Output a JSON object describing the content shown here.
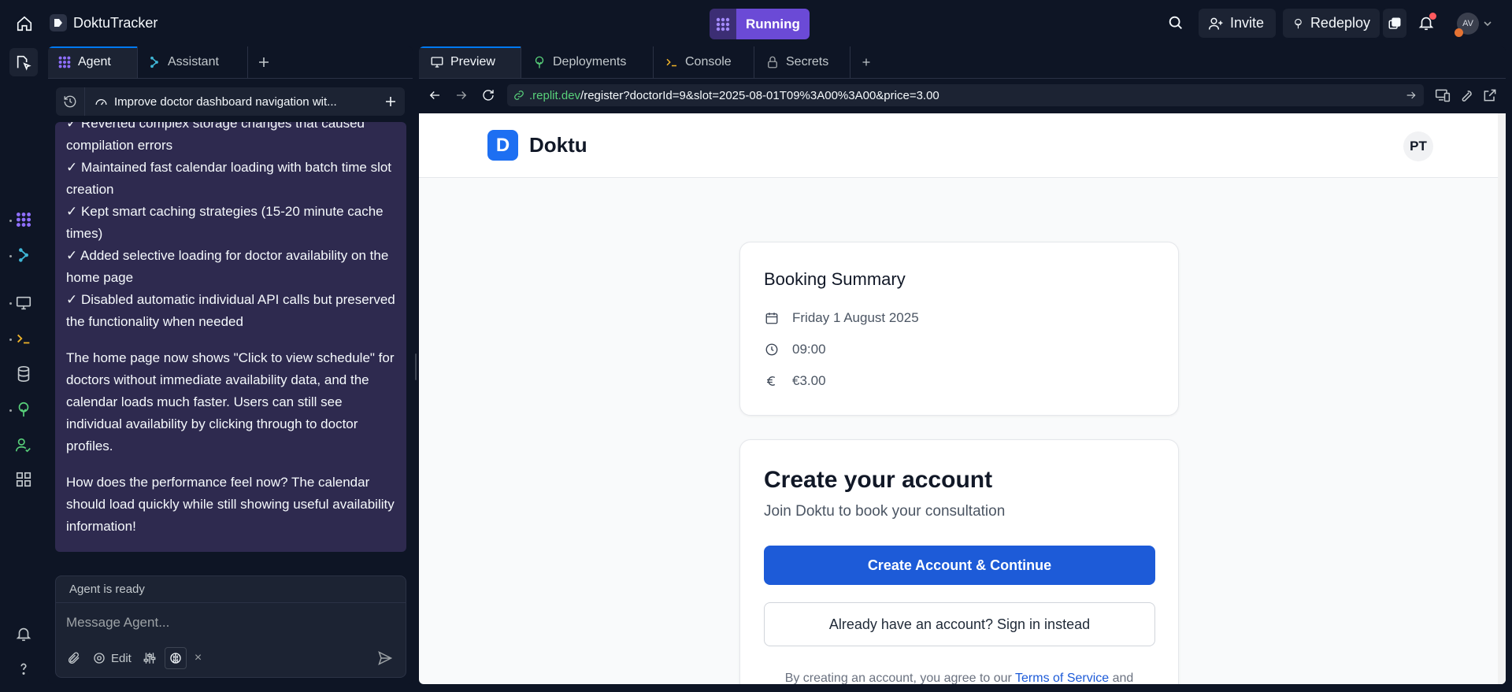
{
  "topbar": {
    "project_name": "DoktuTracker",
    "run_status": "Running",
    "invite_label": "Invite",
    "redeploy_label": "Redeploy",
    "avatar_initials": "AV"
  },
  "left_panel": {
    "tabs": [
      {
        "label": "Agent"
      },
      {
        "label": "Assistant"
      }
    ],
    "thread_title": "Improve doctor dashboard navigation wit...",
    "message": {
      "bullets": [
        "✓ Reverted complex storage changes that caused compilation errors",
        "✓ Maintained fast calendar loading with batch time slot creation",
        "✓ Kept smart caching strategies (15-20 minute cache times)",
        "✓ Added selective loading for doctor availability on the home page",
        "✓ Disabled automatic individual API calls but preserved the functionality when needed"
      ],
      "para1": "The home page now shows \"Click to view schedule\" for doctors without immediate availability data, and the calendar loads much faster. Users can still see individual availability by clicking through to doctor profiles.",
      "para2": "How does the performance feel now? The calendar should load quickly while still showing useful availability information!"
    },
    "input": {
      "status": "Agent is ready",
      "placeholder": "Message Agent...",
      "edit_label": "Edit",
      "close_glyph": "×"
    }
  },
  "right_panel": {
    "tabs": [
      {
        "label": "Preview"
      },
      {
        "label": "Deployments"
      },
      {
        "label": "Console"
      },
      {
        "label": "Secrets"
      }
    ],
    "url": {
      "host": ".replit.dev",
      "path": "/register?doctorId=9&slot=2025-08-01T09%3A00%3A00&price=3.00"
    }
  },
  "app": {
    "brand_letter": "D",
    "brand_name": "Doktu",
    "user_initials": "PT",
    "summary": {
      "title": "Booking Summary",
      "date": "Friday 1 August 2025",
      "time": "09:00",
      "price": "€3.00"
    },
    "account": {
      "title": "Create your account",
      "subtitle": "Join Doktu to book your consultation",
      "primary_button": "Create Account & Continue",
      "secondary_button": "Already have an account? Sign in instead",
      "terms_prefix": "By creating an account, you agree to our ",
      "terms_link": "Terms of Service",
      "terms_suffix": " and"
    }
  },
  "colors": {
    "running_bg": "#6b4ad6",
    "primary_button": "#1d5bd8",
    "url_host": "#58d07a"
  }
}
